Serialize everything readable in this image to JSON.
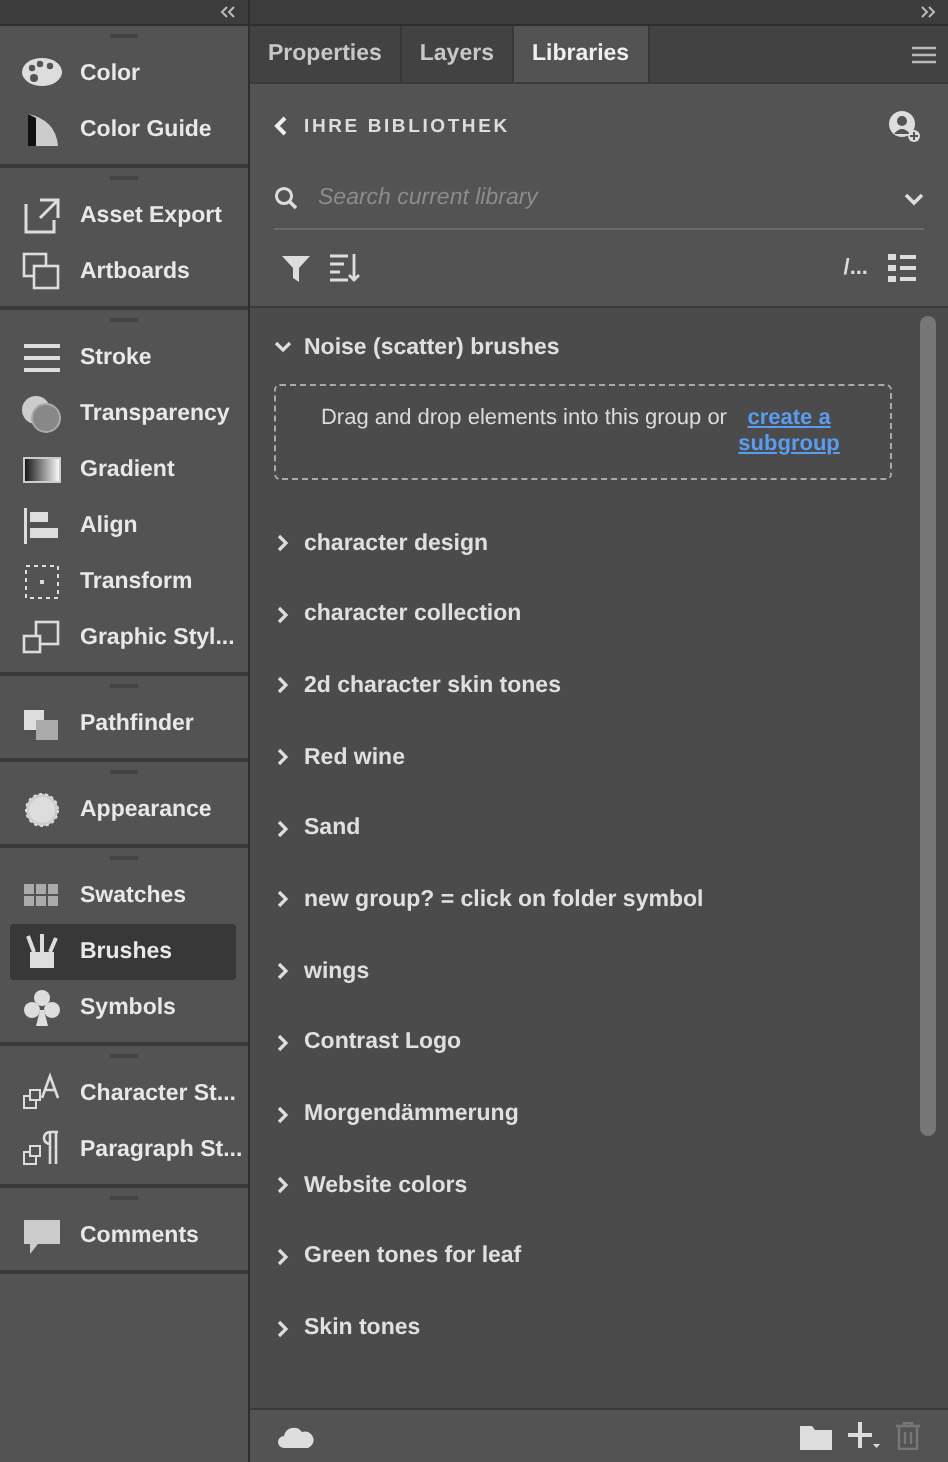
{
  "left_panel": {
    "groups": [
      {
        "items": [
          {
            "label": "Color",
            "selected": false
          },
          {
            "label": "Color Guide",
            "selected": false
          }
        ]
      },
      {
        "items": [
          {
            "label": "Asset Export",
            "selected": false
          },
          {
            "label": "Artboards",
            "selected": false
          }
        ]
      },
      {
        "items": [
          {
            "label": "Stroke",
            "selected": false
          },
          {
            "label": "Transparency",
            "selected": false
          },
          {
            "label": "Gradient",
            "selected": false
          },
          {
            "label": "Align",
            "selected": false
          },
          {
            "label": "Transform",
            "selected": false
          },
          {
            "label": "Graphic Styl...",
            "selected": false
          }
        ]
      },
      {
        "items": [
          {
            "label": "Pathfinder",
            "selected": false
          }
        ]
      },
      {
        "items": [
          {
            "label": "Appearance",
            "selected": false
          }
        ]
      },
      {
        "items": [
          {
            "label": "Swatches",
            "selected": false
          },
          {
            "label": "Brushes",
            "selected": true
          },
          {
            "label": "Symbols",
            "selected": false
          }
        ]
      },
      {
        "items": [
          {
            "label": "Character St...",
            "selected": false
          },
          {
            "label": "Paragraph St...",
            "selected": false
          }
        ]
      },
      {
        "items": [
          {
            "label": "Comments",
            "selected": false
          }
        ]
      }
    ]
  },
  "right_panel": {
    "tabs": [
      {
        "label": "Properties",
        "selected": false
      },
      {
        "label": "Layers",
        "selected": false
      },
      {
        "label": "Libraries",
        "selected": true
      }
    ],
    "library_title": "IHRE BIBLIOTHEK",
    "search": {
      "placeholder": "Search current library"
    },
    "view_label": "/...",
    "groups": [
      {
        "name": "Noise (scatter) brushes",
        "expanded": true,
        "empty_text": "Drag and drop elements into this group or ",
        "link": "create a subgroup"
      },
      {
        "name": "character design",
        "expanded": false
      },
      {
        "name": "character collection",
        "expanded": false
      },
      {
        "name": "2d character skin tones",
        "expanded": false
      },
      {
        "name": "Red wine",
        "expanded": false
      },
      {
        "name": "Sand",
        "expanded": false
      },
      {
        "name": "new group? = click on folder symbol",
        "expanded": false
      },
      {
        "name": "wings",
        "expanded": false
      },
      {
        "name": "Contrast Logo",
        "expanded": false
      },
      {
        "name": "Morgendämmerung",
        "expanded": false
      },
      {
        "name": "Website colors",
        "expanded": false
      },
      {
        "name": "Green tones for leaf",
        "expanded": false
      },
      {
        "name": "Skin tones",
        "expanded": false
      }
    ]
  }
}
